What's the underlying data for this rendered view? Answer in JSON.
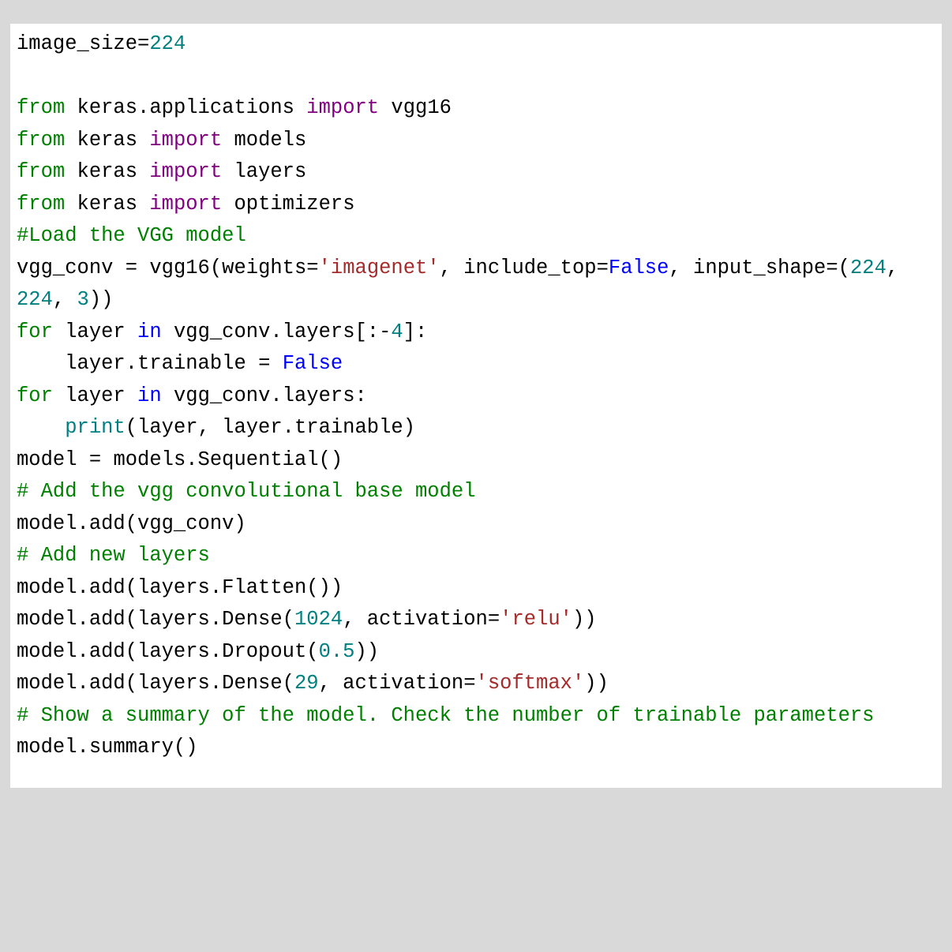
{
  "code": {
    "l01_a": "image_size",
    "l01_b": "=",
    "l01_c": "224",
    "l03_a": "from",
    "l03_b": " keras.applications ",
    "l03_c": "import",
    "l03_d": " vgg16",
    "l04_a": "from",
    "l04_b": " keras ",
    "l04_c": "import",
    "l04_d": " models",
    "l05_a": "from",
    "l05_b": " keras ",
    "l05_c": "import",
    "l05_d": " layers",
    "l06_a": "from",
    "l06_b": " keras ",
    "l06_c": "import",
    "l06_d": " optimizers",
    "l07": "#Load the VGG model",
    "l08_a": "vgg_conv ",
    "l08_b": "=",
    "l08_c": " vgg16(weights",
    "l08_d": "=",
    "l08_e": "'imagenet'",
    "l08_f": ", include_top",
    "l08_g": "=",
    "l08_h": "False",
    "l08_i": ", input_shape",
    "l08_j": "=",
    "l08_k": "(",
    "l08_l": "224",
    "l08_m": ", ",
    "l08_n": "224",
    "l08_o": ", ",
    "l08_p": "3",
    "l08_q": "))",
    "l09_a": "for",
    "l09_b": " layer ",
    "l09_c": "in",
    "l09_d": " vgg_conv.layers[:",
    "l09_e": "-",
    "l09_f": "4",
    "l09_g": "]:",
    "l10_a": "    layer.trainable ",
    "l10_b": "=",
    "l10_c": " ",
    "l10_d": "False",
    "l11_a": "for",
    "l11_b": " layer ",
    "l11_c": "in",
    "l11_d": " vgg_conv.layers:",
    "l12_a": "    ",
    "l12_b": "print",
    "l12_c": "(layer, layer.trainable)",
    "l13_a": "model ",
    "l13_b": "=",
    "l13_c": " models.Sequential()",
    "l14": "# Add the vgg convolutional base model",
    "l15": "model.add(vgg_conv)",
    "l16": "# Add new layers",
    "l17": "model.add(layers.Flatten())",
    "l18_a": "model.add(layers.Dense(",
    "l18_b": "1024",
    "l18_c": ", activation",
    "l18_d": "=",
    "l18_e": "'relu'",
    "l18_f": "))",
    "l19_a": "model.add(layers.Dropout(",
    "l19_b": "0.5",
    "l19_c": "))",
    "l20_a": "model.add(layers.Dense(",
    "l20_b": "29",
    "l20_c": ", activation",
    "l20_d": "=",
    "l20_e": "'softmax'",
    "l20_f": "))",
    "l21": "# Show a summary of the model. Check the number of trainable parameters",
    "l22": "model.summary()"
  }
}
